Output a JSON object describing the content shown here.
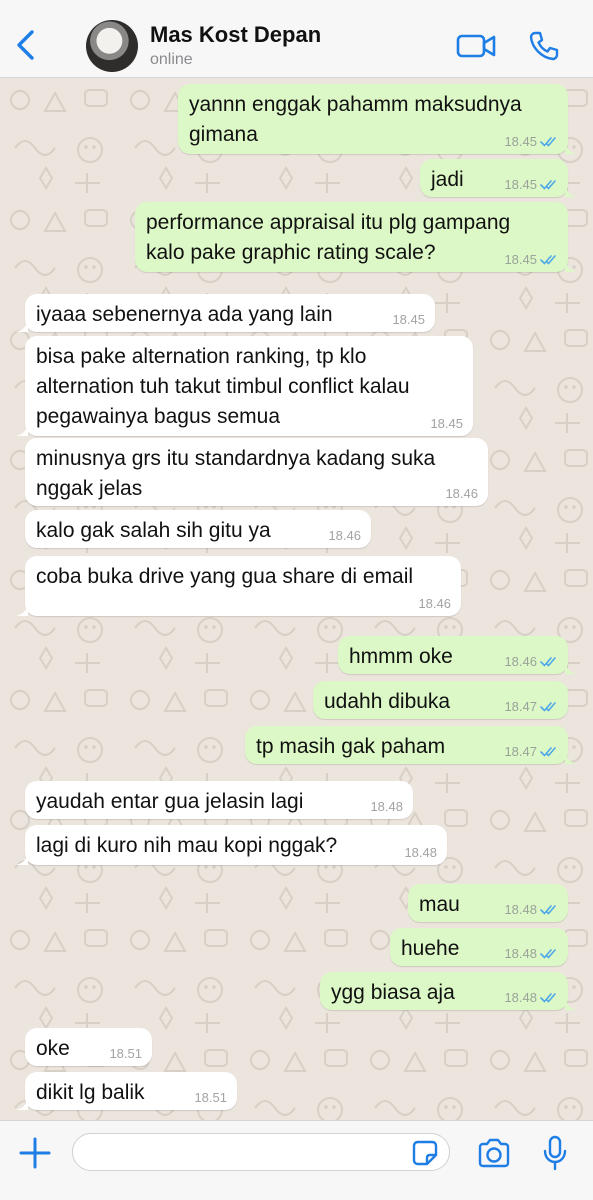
{
  "header": {
    "contact_name": "Mas Kost Depan",
    "status": "online"
  },
  "colors": {
    "accent": "#1e7ee6",
    "bubble_out": "#dcf8c6",
    "bubble_in": "#ffffff",
    "read_tick": "#4fa8e8",
    "wallpaper": "#ece5dd"
  },
  "messages": [
    {
      "dir": "out",
      "text": "yannn enggak pahamm maksudnya\ngimana",
      "time": "18.45",
      "read": true
    },
    {
      "dir": "out",
      "text": "jadi",
      "time": "18.45",
      "read": true
    },
    {
      "dir": "out",
      "text": "performance appraisal itu plg gampang\nkalo pake graphic rating scale?",
      "time": "18.45",
      "read": true
    },
    {
      "dir": "in",
      "text": "iyaaa sebenernya ada yang lain",
      "time": "18.45"
    },
    {
      "dir": "in",
      "text": "bisa pake alternation ranking, tp klo\nalternation tuh takut timbul conflict kalau\npegawainya bagus semua",
      "time": "18.45"
    },
    {
      "dir": "in",
      "text": "minusnya grs itu standardnya kadang suka\nnggak jelas",
      "time": "18.46"
    },
    {
      "dir": "in",
      "text": "kalo gak salah sih gitu ya",
      "time": "18.46"
    },
    {
      "dir": "in",
      "text": "coba buka drive yang gua share di email",
      "time": "18.46"
    },
    {
      "dir": "out",
      "text": "hmmm oke",
      "time": "18.46",
      "read": true
    },
    {
      "dir": "out",
      "text": "udahh dibuka",
      "time": "18.47",
      "read": true
    },
    {
      "dir": "out",
      "text": "tp masih gak paham",
      "time": "18.47",
      "read": true
    },
    {
      "dir": "in",
      "text": "yaudah entar gua jelasin lagi",
      "time": "18.48"
    },
    {
      "dir": "in",
      "text": "lagi di kuro nih mau kopi nggak?",
      "time": "18.48"
    },
    {
      "dir": "out",
      "text": "mau",
      "time": "18.48",
      "read": true
    },
    {
      "dir": "out",
      "text": "huehe",
      "time": "18.48",
      "read": true
    },
    {
      "dir": "out",
      "text": "ygg biasa aja",
      "time": "18.48",
      "read": true
    },
    {
      "dir": "in",
      "text": "oke",
      "time": "18.51"
    },
    {
      "dir": "in",
      "text": "dikit lg balik",
      "time": "18.51"
    }
  ],
  "input": {
    "placeholder": "",
    "value": ""
  },
  "icons": {
    "back": "chevron-left-icon",
    "video": "video-camera-icon",
    "call": "phone-icon",
    "plus": "plus-icon",
    "sticker": "sticker-icon",
    "camera": "camera-icon",
    "mic": "microphone-icon"
  }
}
